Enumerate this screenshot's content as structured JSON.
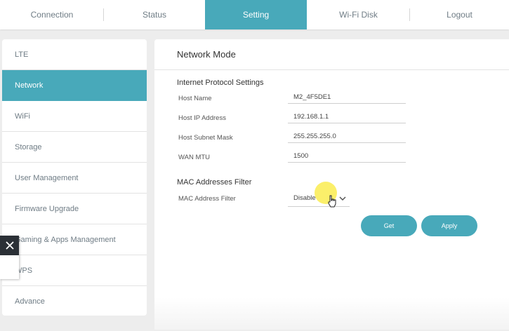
{
  "topnav": {
    "tabs": [
      {
        "label": "Connection"
      },
      {
        "label": "Status"
      },
      {
        "label": "Setting"
      },
      {
        "label": "Wi-Fi Disk"
      },
      {
        "label": "Logout"
      }
    ],
    "active": "Setting"
  },
  "sidebar": {
    "items": [
      {
        "label": "LTE"
      },
      {
        "label": "Network"
      },
      {
        "label": "WiFi"
      },
      {
        "label": "Storage"
      },
      {
        "label": "User Management"
      },
      {
        "label": "Firmware Upgrade"
      },
      {
        "label": "Gaming & Apps Management"
      },
      {
        "label": "WPS"
      },
      {
        "label": "Advance"
      }
    ],
    "active": "Network"
  },
  "main": {
    "title": "Network Mode",
    "ip_section": {
      "title": "Internet Protocol Settings",
      "rows": [
        {
          "label": "Host Name",
          "value": "M2_4F5DE1"
        },
        {
          "label": "Host IP Address",
          "value": "192.168.1.1"
        },
        {
          "label": "Host Subnet Mask",
          "value": "255.255.255.0"
        },
        {
          "label": "WAN MTU",
          "value": "1500"
        }
      ]
    },
    "mac_section": {
      "title": "MAC Addresses Filter",
      "label": "MAC Address Filter",
      "value": "Disable"
    },
    "buttons": {
      "get": "Get",
      "apply": "Apply"
    }
  },
  "colors": {
    "accent": "#48a9ba",
    "background": "#ededed",
    "overlay_close": "#2b3036",
    "cursor_highlight": "#faec50"
  },
  "icons": {
    "dropdown": "chevron-down-icon",
    "overlay_close": "close-icon",
    "cursor": "hand-pointer-icon"
  }
}
